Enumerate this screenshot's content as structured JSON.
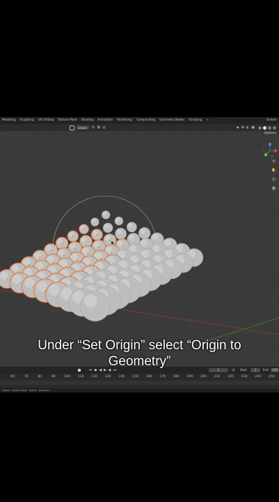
{
  "workspace_tabs": [
    "Modeling",
    "Sculpting",
    "UV Editing",
    "Texture Paint",
    "Shading",
    "Animation",
    "Rendering",
    "Compositing",
    "Geometry Nodes",
    "Scripting",
    "+"
  ],
  "scene_label": "Scene",
  "viewport_header": {
    "orientation": "Global"
  },
  "options_label": "Options",
  "timeline": {
    "current_frame": "1",
    "start_label": "Start",
    "start_value": "1",
    "end_label": "End",
    "end_value": "250",
    "ruler_ticks": [
      "60",
      "70",
      "80",
      "90",
      "100",
      "110",
      "120",
      "130",
      "140",
      "150",
      "160",
      "170",
      "180",
      "190",
      "200",
      "210",
      "220",
      "230",
      "240",
      "250"
    ]
  },
  "status_bar": [
    "Select",
    "Rotate View",
    "Select",
    "Deselect"
  ],
  "caption": {
    "line1": "Under “Set Origin” select “Origin to",
    "line2": "Geometry”"
  },
  "colors": {
    "viewport_bg": "#3a3a3a",
    "selection_outline": "#e8732f",
    "sphere_fill": "#bdbdbd",
    "grid_line": "#444444",
    "x_axis": "#a23a3a",
    "y_axis": "#5a8a2a"
  }
}
